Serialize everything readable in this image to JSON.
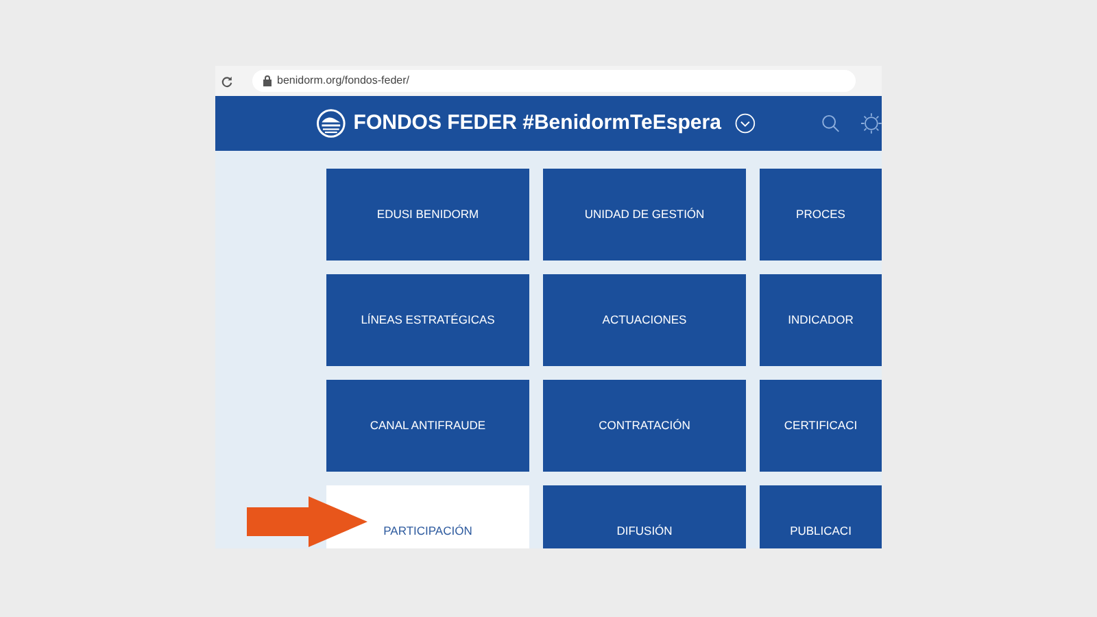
{
  "address_bar": {
    "url": "benidorm.org/fondos-feder/"
  },
  "header": {
    "title": "FONDOS FEDER #BenidormTeEspera"
  },
  "tiles": [
    {
      "label": "EDUSI BENIDORM",
      "selected": false
    },
    {
      "label": "UNIDAD DE GESTIÓN",
      "selected": false
    },
    {
      "label": "PROCES",
      "selected": false
    },
    {
      "label": "LÍNEAS ESTRATÉGICAS",
      "selected": false
    },
    {
      "label": "ACTUACIONES",
      "selected": false
    },
    {
      "label": "INDICADOR",
      "selected": false
    },
    {
      "label": "CANAL ANTIFRAUDE",
      "selected": false
    },
    {
      "label": "CONTRATACIÓN",
      "selected": false
    },
    {
      "label": "CERTIFICACI",
      "selected": false
    },
    {
      "label": "PARTICIPACIÓN",
      "selected": true
    },
    {
      "label": "DIFUSIÓN",
      "selected": false
    },
    {
      "label": "PUBLICACI",
      "selected": false
    }
  ]
}
